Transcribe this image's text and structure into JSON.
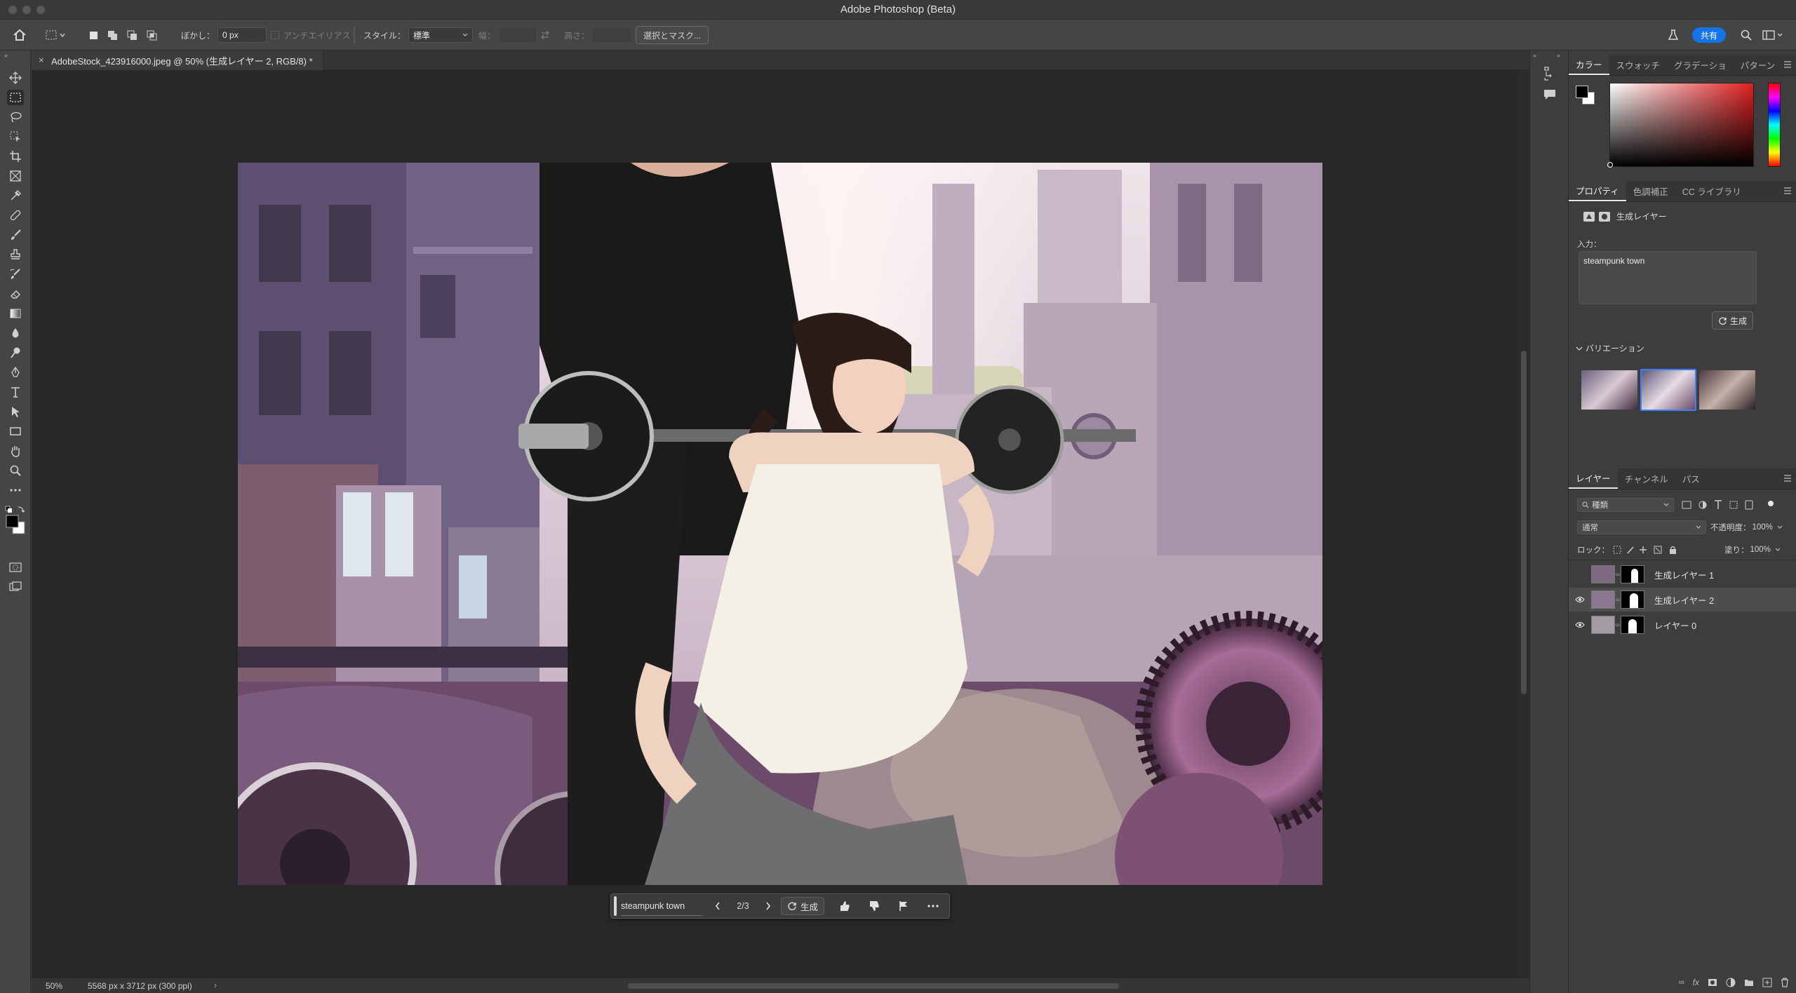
{
  "window": {
    "title": "Adobe Photoshop (Beta)"
  },
  "options_bar": {
    "feather_label": "ぼかし：",
    "feather_value": "0 px",
    "antialias_label": "アンチエイリアス",
    "style_label": "スタイル：",
    "style_value": "標準",
    "width_label": "幅：",
    "height_label": "高さ：",
    "select_mask_label": "選択とマスク..."
  },
  "top_right": {
    "share_label": "共有"
  },
  "document": {
    "tab_title": "AdobeStock_423916000.jpeg @ 50% (生成レイヤー 2, RGB/8) *",
    "zoom": "50%",
    "dimensions": "5568 px x 3712 px (300 ppi)"
  },
  "color_panel": {
    "tabs": [
      "カラー",
      "スウォッチ",
      "グラデーショ",
      "パターン"
    ],
    "active_tab": "カラー",
    "foreground": "#000000",
    "background": "#ffffff",
    "hue_color": "#e02020"
  },
  "properties_panel": {
    "tabs": [
      "プロパティ",
      "色調補正",
      "CC ライブラリ"
    ],
    "layer_type": "生成レイヤー",
    "prompt_label": "入力：",
    "prompt_value": "steampunk town",
    "generate_label": "生成",
    "variations_label": "バリエーション",
    "variation_count": 3,
    "selected_variation": 2
  },
  "layers_panel": {
    "tabs": [
      "レイヤー",
      "チャンネル",
      "パス"
    ],
    "filter_kind": "種類",
    "blend_mode": "通常",
    "opacity_label": "不透明度：",
    "opacity_value": "100%",
    "lock_label": "ロック：",
    "fill_label": "塗り：",
    "fill_value": "100%",
    "layers": [
      {
        "name": "生成レイヤー 1",
        "visible": false,
        "selected": false
      },
      {
        "name": "生成レイヤー 2",
        "visible": true,
        "selected": true
      },
      {
        "name": "レイヤー 0",
        "visible": true,
        "selected": false
      }
    ]
  },
  "generative_bar": {
    "prompt": "steampunk town",
    "counter": "2/3",
    "generate_label": "生成"
  }
}
